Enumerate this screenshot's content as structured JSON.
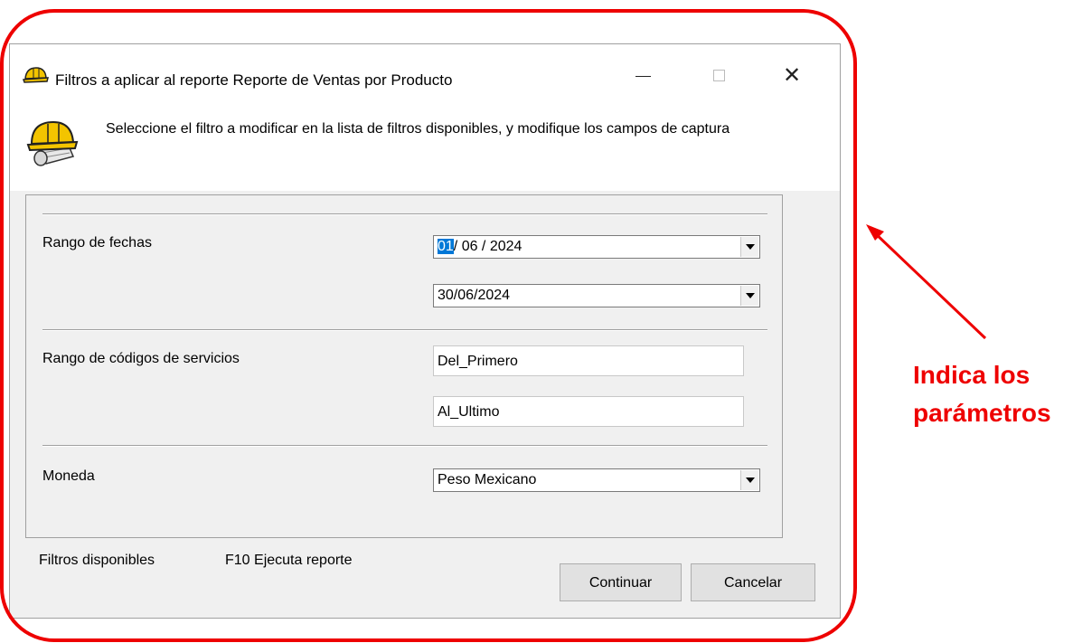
{
  "window": {
    "title": "Filtros a aplicar al reporte Reporte de Ventas por Producto",
    "close_glyph": "✕",
    "icon": "hardhat-icon"
  },
  "header": {
    "instruction": "Seleccione el filtro a modificar  en la lista de filtros disponibles, y modifique los campos de  captura",
    "icon": "hardhat-blueprint-icon"
  },
  "filters": {
    "date_range": {
      "label": "Rango de fechas",
      "from_day": "01",
      "from_rest": "/ 06 / 2024",
      "to": "30/06/2024"
    },
    "service_codes": {
      "label": "Rango de códigos de servicios",
      "from": "Del_Primero",
      "to": "Al_Ultimo"
    },
    "currency": {
      "label": "Moneda",
      "value": "Peso Mexicano"
    }
  },
  "footer": {
    "available_filters": "Filtros disponibles",
    "f10_hint": "F10 Ejecuta reporte",
    "continue_label": "Continuar",
    "cancel_label": "Cancelar"
  },
  "annotation": {
    "line1": "Indica los",
    "line2": "parámetros",
    "color": "#ee0000"
  }
}
